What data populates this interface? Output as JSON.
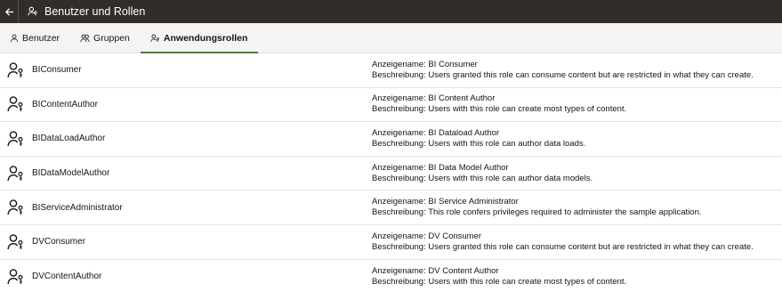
{
  "window": {
    "title": "Benutzer und Rollen"
  },
  "tabs": [
    {
      "label": "Benutzer",
      "icon": "user-icon",
      "active": false
    },
    {
      "label": "Gruppen",
      "icon": "group-icon",
      "active": false
    },
    {
      "label": "Anwendungsrollen",
      "icon": "role-icon",
      "active": true
    }
  ],
  "roles": [
    {
      "name": "BIConsumer",
      "display": "Anzeigename: BI Consumer",
      "description": "Beschreibung: Users granted this role can consume content but are restricted in what they can create."
    },
    {
      "name": "BIContentAuthor",
      "display": "Anzeigename: BI Content Author",
      "description": "Beschreibung: Users with this role can create most types of content."
    },
    {
      "name": "BIDataLoadAuthor",
      "display": "Anzeigename: BI Dataload Author",
      "description": "Beschreibung: Users with this role can author data loads."
    },
    {
      "name": "BIDataModelAuthor",
      "display": "Anzeigename: BI Data Model Author",
      "description": "Beschreibung: Users with this role can author data models."
    },
    {
      "name": "BIServiceAdministrator",
      "display": "Anzeigename: BI Service Administrator",
      "description": "Beschreibung: This role confers privileges required to administer the sample application."
    },
    {
      "name": "DVConsumer",
      "display": "Anzeigename: DV Consumer",
      "description": "Beschreibung: Users granted this role can consume content but are restricted in what they can create."
    },
    {
      "name": "DVContentAuthor",
      "display": "Anzeigename: DV Content Author",
      "description": "Beschreibung: Users with this role can create most types of content."
    }
  ]
}
